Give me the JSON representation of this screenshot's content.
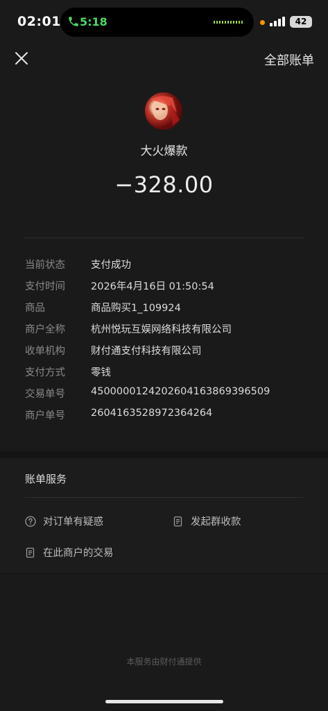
{
  "status_bar": {
    "time": "02:01",
    "call_time": "5:18",
    "battery": "42"
  },
  "header": {
    "close_icon": "close-icon",
    "all_bills_label": "全部账单"
  },
  "merchant": {
    "name": "大火爆款",
    "amount": "−328.00"
  },
  "details": [
    {
      "label": "当前状态",
      "value": "支付成功"
    },
    {
      "label": "支付时间",
      "value": "2026年4月16日 01:50:54"
    },
    {
      "label": "商品",
      "value": "商品购买1_109924"
    },
    {
      "label": "商户全称",
      "value": "杭州悦玩互娱网络科技有限公司"
    },
    {
      "label": "收单机构",
      "value": "财付通支付科技有限公司"
    },
    {
      "label": "支付方式",
      "value": "零钱"
    },
    {
      "label": "交易单号",
      "value": "4500000124202604163869396509"
    },
    {
      "label": "商户单号",
      "value": "2604163528972364264"
    }
  ],
  "services": {
    "title": "账单服务",
    "items": [
      {
        "label": "对订单有疑惑",
        "icon": "question-icon"
      },
      {
        "label": "发起群收款",
        "icon": "document-icon"
      },
      {
        "label": "在此商户的交易",
        "icon": "document-icon"
      }
    ]
  },
  "footer": {
    "note": "本服务由财付通提供"
  },
  "colors": {
    "background": "#1a1a1a",
    "call_green": "#4cd964",
    "recording_dot": "#ff9500"
  }
}
